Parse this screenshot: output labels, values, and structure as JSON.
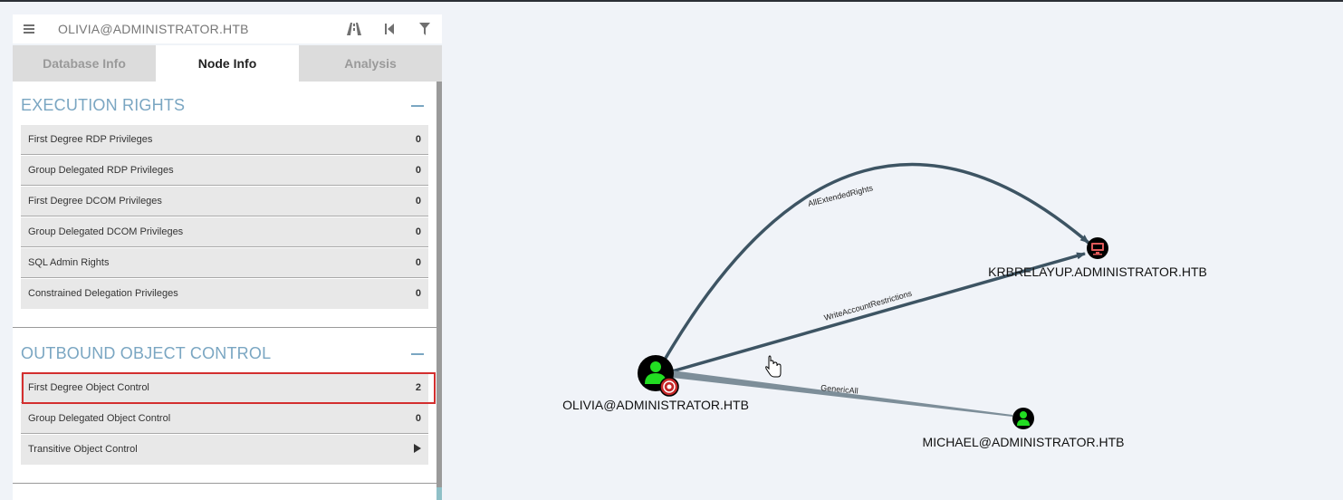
{
  "search": {
    "value": "OLIVIA@ADMINISTRATOR.HTB"
  },
  "toolbar": {
    "icons": [
      "menu-icon",
      "pathfinding-icon",
      "back-icon",
      "filter-icon"
    ]
  },
  "tabs": [
    {
      "label": "Database Info",
      "active": false
    },
    {
      "label": "Node Info",
      "active": true
    },
    {
      "label": "Analysis",
      "active": false
    }
  ],
  "execution_rights": {
    "title": "EXECUTION RIGHTS",
    "rows": [
      {
        "label": "First Degree RDP Privileges",
        "value": "0"
      },
      {
        "label": "Group Delegated RDP Privileges",
        "value": "0"
      },
      {
        "label": "First Degree DCOM Privileges",
        "value": "0"
      },
      {
        "label": "Group Delegated DCOM Privileges",
        "value": "0"
      },
      {
        "label": "SQL Admin Rights",
        "value": "0"
      },
      {
        "label": "Constrained Delegation Privileges",
        "value": "0"
      }
    ]
  },
  "outbound_control": {
    "title": "OUTBOUND OBJECT CONTROL",
    "rows": [
      {
        "label": "First Degree Object Control",
        "value": "2"
      },
      {
        "label": "Group Delegated Object Control",
        "value": "0"
      },
      {
        "label": "Transitive Object Control",
        "value": ""
      }
    ]
  },
  "graph": {
    "nodes": [
      {
        "id": "olivia",
        "label": "OLIVIA@ADMINISTRATOR.HTB",
        "kind": "user",
        "owned_target": true
      },
      {
        "id": "krbrelayup",
        "label": "KRBRELAYUP.ADMINISTRATOR.HTB",
        "kind": "computer"
      },
      {
        "id": "michael",
        "label": "MICHAEL@ADMINISTRATOR.HTB",
        "kind": "user"
      }
    ],
    "edges": [
      {
        "from": "olivia",
        "to": "krbrelayup",
        "label": "AllExtendedRights"
      },
      {
        "from": "olivia",
        "to": "krbrelayup",
        "label": "WriteAccountRestrictions"
      },
      {
        "from": "olivia",
        "to": "michael",
        "label": "GenericAll"
      }
    ]
  },
  "colors": {
    "section_title": "#7aa6c2",
    "highlight": "#d32f2f",
    "edge": "#3d5463",
    "user_icon": "#22dd22",
    "computer_icon": "#e05a5a",
    "target_badge": "#c62828"
  }
}
